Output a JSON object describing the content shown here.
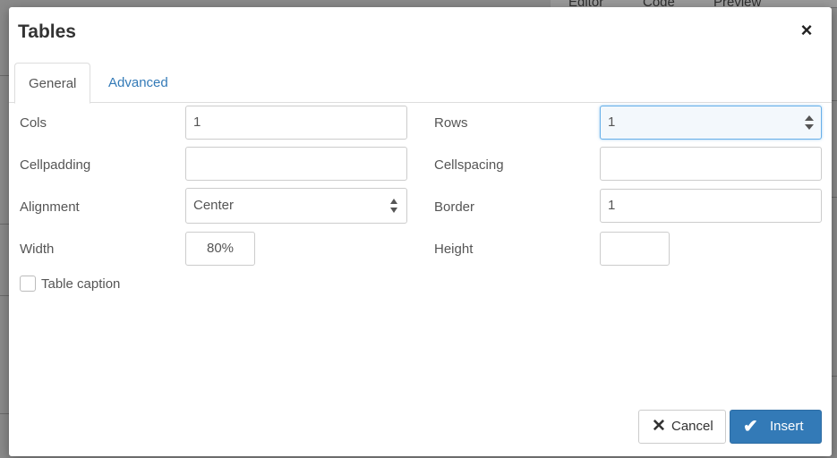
{
  "background": {
    "tabs": [
      "Editor",
      "Code",
      "Preview"
    ]
  },
  "dialog": {
    "title": "Tables",
    "close_icon": "close-icon",
    "tabs": [
      {
        "label": "General",
        "active": true
      },
      {
        "label": "Advanced",
        "active": false
      }
    ],
    "fields": {
      "cols": {
        "label": "Cols",
        "value": "1"
      },
      "rows": {
        "label": "Rows",
        "value": "1"
      },
      "cellpadding": {
        "label": "Cellpadding",
        "value": ""
      },
      "cellspacing": {
        "label": "Cellspacing",
        "value": ""
      },
      "alignment": {
        "label": "Alignment",
        "value": "Center"
      },
      "border": {
        "label": "Border",
        "value": "1"
      },
      "width": {
        "label": "Width",
        "value": "80%"
      },
      "height": {
        "label": "Height",
        "value": ""
      }
    },
    "table_caption": {
      "label": "Table caption",
      "checked": false
    },
    "buttons": {
      "cancel": {
        "label": "Cancel",
        "icon": "close-icon"
      },
      "insert": {
        "label": "Insert",
        "icon": "check-icon"
      }
    },
    "colors": {
      "primary": "#337ab7",
      "link": "#337ab7",
      "focus_border": "#66afe9"
    }
  }
}
